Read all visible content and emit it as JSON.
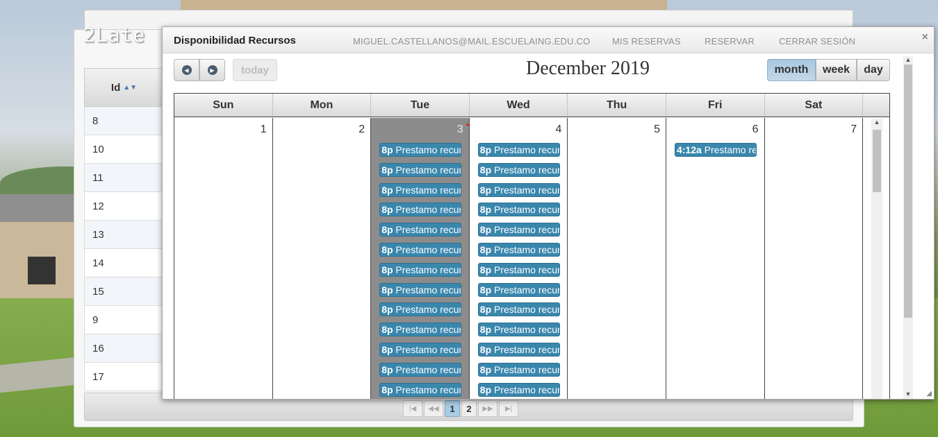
{
  "background_page": {
    "logo_text": "2Late",
    "table": {
      "header": "Id",
      "rows": [
        "8",
        "10",
        "11",
        "12",
        "13",
        "14",
        "15",
        "9",
        "16",
        "17"
      ]
    },
    "pager": {
      "first": "|◀",
      "prev": "◀◀",
      "pages": [
        "1",
        "2"
      ],
      "active_page": "1",
      "next": "▶▶",
      "last": "▶|"
    }
  },
  "modal": {
    "brand": "Disponibilidad Recursos",
    "nav": {
      "user_email": "MIGUEL.CASTELLANOS@MAIL.ESCUELAING.EDU.CO",
      "my_reservations": "MIS RESERVAS",
      "reserve": "RESERVAR",
      "logout": "CERRAR SESIÓN"
    },
    "close_label": "×",
    "calendar": {
      "title": "December 2019",
      "today_label": "today",
      "prev_icon": "chevron-left-icon",
      "next_icon": "chevron-right-icon",
      "views": {
        "month": "month",
        "week": "week",
        "day": "day"
      },
      "active_view": "month",
      "weekdays": [
        "Sun",
        "Mon",
        "Tue",
        "Wed",
        "Thu",
        "Fri",
        "Sat"
      ],
      "days": [
        {
          "number": "1",
          "events": []
        },
        {
          "number": "2",
          "events": []
        },
        {
          "number": "3",
          "today": true,
          "events": [
            {
              "time": "8p",
              "title": "Prestamo recurso"
            },
            {
              "time": "8p",
              "title": "Prestamo recurso"
            },
            {
              "time": "8p",
              "title": "Prestamo recurso"
            },
            {
              "time": "8p",
              "title": "Prestamo recurso"
            },
            {
              "time": "8p",
              "title": "Prestamo recurso"
            },
            {
              "time": "8p",
              "title": "Prestamo recurso"
            },
            {
              "time": "8p",
              "title": "Prestamo recurso"
            },
            {
              "time": "8p",
              "title": "Prestamo recurso"
            },
            {
              "time": "8p",
              "title": "Prestamo recurso"
            },
            {
              "time": "8p",
              "title": "Prestamo recurso"
            },
            {
              "time": "8p",
              "title": "Prestamo recurso"
            },
            {
              "time": "8p",
              "title": "Prestamo recurso"
            },
            {
              "time": "8p",
              "title": "Prestamo recurso"
            }
          ]
        },
        {
          "number": "4",
          "events": [
            {
              "time": "8p",
              "title": "Prestamo recurso"
            },
            {
              "time": "8p",
              "title": "Prestamo recurso"
            },
            {
              "time": "8p",
              "title": "Prestamo recurso"
            },
            {
              "time": "8p",
              "title": "Prestamo recurso"
            },
            {
              "time": "8p",
              "title": "Prestamo recurso"
            },
            {
              "time": "8p",
              "title": "Prestamo recurso"
            },
            {
              "time": "8p",
              "title": "Prestamo recurso"
            },
            {
              "time": "8p",
              "title": "Prestamo recurso"
            },
            {
              "time": "8p",
              "title": "Prestamo recurso"
            },
            {
              "time": "8p",
              "title": "Prestamo recurso"
            },
            {
              "time": "8p",
              "title": "Prestamo recurso"
            },
            {
              "time": "8p",
              "title": "Prestamo recurso"
            },
            {
              "time": "8p",
              "title": "Prestamo recurso"
            }
          ]
        },
        {
          "number": "5",
          "events": []
        },
        {
          "number": "6",
          "events": [
            {
              "time": "4:12a",
              "title": "Prestamo recurso"
            }
          ]
        },
        {
          "number": "7",
          "events": []
        }
      ]
    }
  },
  "colors": {
    "event_bg": "#3a87ad",
    "today_bg": "#8c8c8c",
    "active_view_bg": "#a8c7de"
  }
}
